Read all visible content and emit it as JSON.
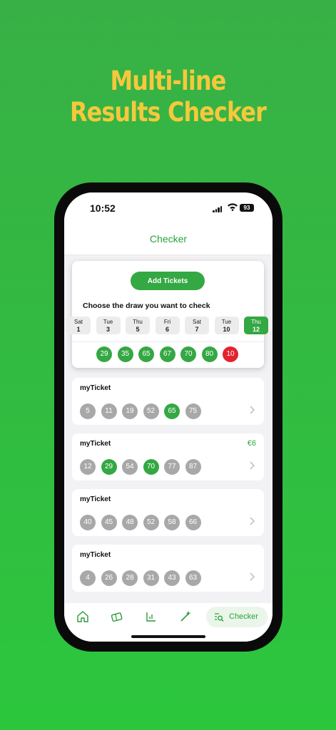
{
  "hero": {
    "line1": "Multi-line",
    "line2": "Results Checker"
  },
  "status_bar": {
    "time": "10:52",
    "battery": "93"
  },
  "header": {
    "title": "Checker"
  },
  "checker": {
    "add_button_label": "Add Tickets",
    "choose_label": "Choose the draw you want to check",
    "draw_days": [
      {
        "name": "Sat",
        "date": "1"
      },
      {
        "name": "Tue",
        "date": "3"
      },
      {
        "name": "Thu",
        "date": "5"
      },
      {
        "name": "Fri",
        "date": "6"
      },
      {
        "name": "Sat",
        "date": "7"
      },
      {
        "name": "Tue",
        "date": "10"
      },
      {
        "name": "Thu",
        "date": "12",
        "selected": true
      }
    ],
    "draw_numbers": [
      "29",
      "35",
      "65",
      "67",
      "70",
      "80"
    ],
    "bonus_number": "10"
  },
  "tickets": [
    {
      "name": "myTicket",
      "prize": "",
      "numbers": [
        {
          "n": "5",
          "match": false
        },
        {
          "n": "11",
          "match": false
        },
        {
          "n": "19",
          "match": false
        },
        {
          "n": "52",
          "match": false
        },
        {
          "n": "65",
          "match": true
        },
        {
          "n": "75",
          "match": false
        }
      ]
    },
    {
      "name": "myTicket",
      "prize": "€6",
      "numbers": [
        {
          "n": "12",
          "match": false
        },
        {
          "n": "29",
          "match": true
        },
        {
          "n": "54",
          "match": false
        },
        {
          "n": "70",
          "match": true
        },
        {
          "n": "77",
          "match": false
        },
        {
          "n": "87",
          "match": false
        }
      ]
    },
    {
      "name": "myTicket",
      "prize": "",
      "numbers": [
        {
          "n": "40",
          "match": false
        },
        {
          "n": "45",
          "match": false
        },
        {
          "n": "48",
          "match": false
        },
        {
          "n": "52",
          "match": false
        },
        {
          "n": "58",
          "match": false
        },
        {
          "n": "66",
          "match": false
        }
      ]
    },
    {
      "name": "myTicket",
      "prize": "",
      "numbers": [
        {
          "n": "4",
          "match": false
        },
        {
          "n": "26",
          "match": false
        },
        {
          "n": "28",
          "match": false
        },
        {
          "n": "31",
          "match": false
        },
        {
          "n": "43",
          "match": false
        },
        {
          "n": "63",
          "match": false
        }
      ]
    }
  ],
  "tabbar": {
    "tabs": [
      "home-icon",
      "tickets-icon",
      "stats-icon",
      "generator-icon",
      "checker-icon"
    ],
    "active_label": "Checker"
  },
  "colors": {
    "background": "#2cc63d",
    "accent": "#34a843",
    "hero_text": "#f6c83c",
    "bonus": "#e3232d",
    "unmatched": "#a8a8a8"
  }
}
